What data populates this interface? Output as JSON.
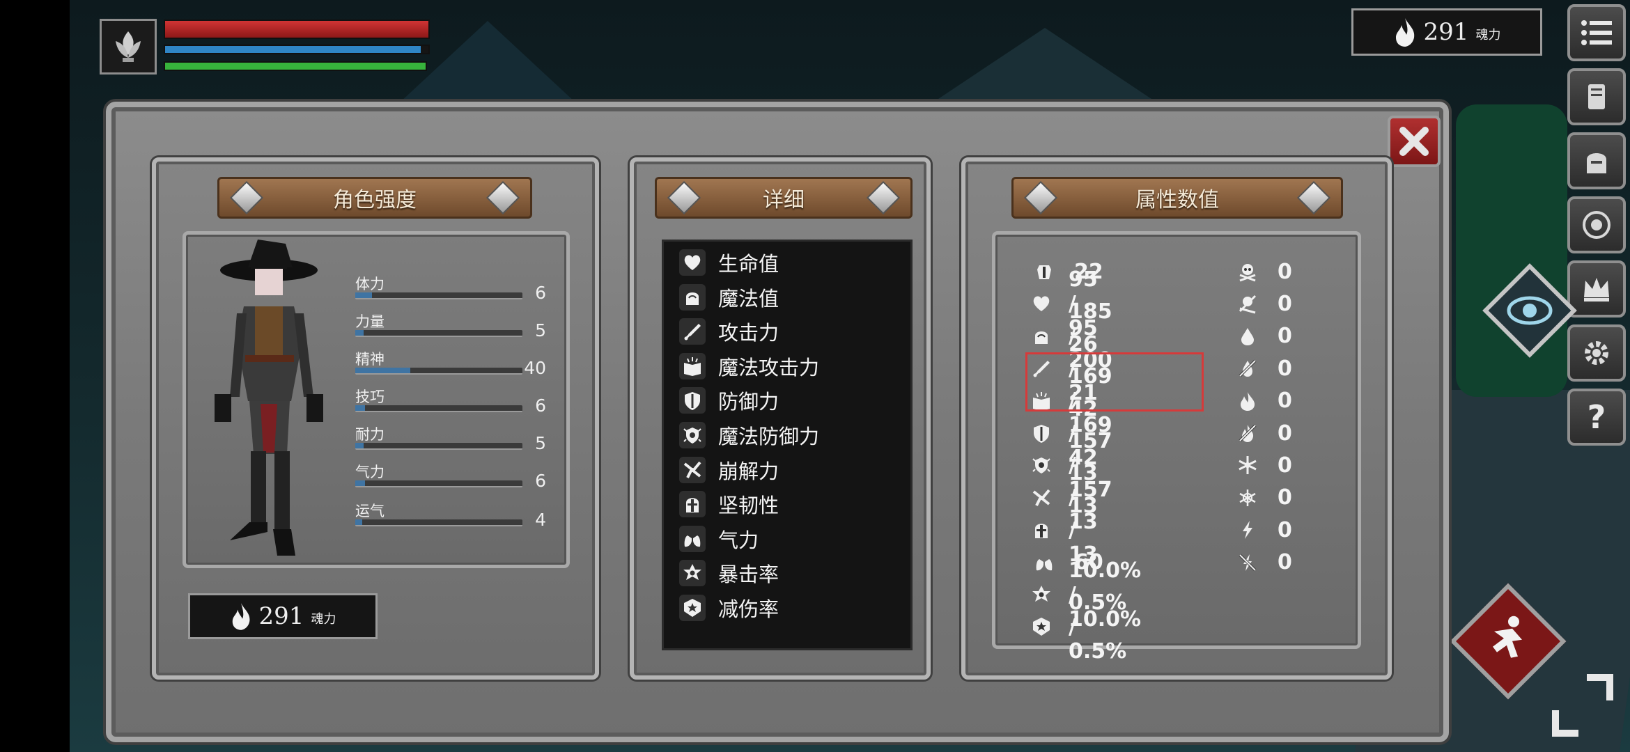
{
  "hud": {
    "portrait_icon": "lotus-emblem-icon",
    "health_fill": 1.0,
    "mana_fill": 0.97,
    "stamina_fill": 1.0,
    "colors": {
      "health": "#b32020",
      "mana": "#2f86c6",
      "stamina": "#37b33c"
    }
  },
  "soul_top": {
    "value": "291",
    "unit": "魂力",
    "icon": "flame-icon"
  },
  "menu": [
    {
      "name": "menu-list-button",
      "icon": "list-icon"
    },
    {
      "name": "inventory-button",
      "icon": "scroll-icon"
    },
    {
      "name": "equipment-button",
      "icon": "helmet-icon"
    },
    {
      "name": "skills-button",
      "icon": "emblem-icon"
    },
    {
      "name": "rank-button",
      "icon": "crown-icon"
    },
    {
      "name": "settings-button",
      "icon": "gear-icon"
    },
    {
      "name": "help-button",
      "label": "?",
      "icon": "question-icon"
    }
  ],
  "panels": {
    "character": {
      "title": "角色强度"
    },
    "detail": {
      "title": "详细"
    },
    "values": {
      "title": "属性数值"
    }
  },
  "stats": [
    {
      "label": "体力",
      "value": "6",
      "fill": 0.1
    },
    {
      "label": "力量",
      "value": "5",
      "fill": 0.05
    },
    {
      "label": "精神",
      "value": "40",
      "fill": 0.33
    },
    {
      "label": "技巧",
      "value": "6",
      "fill": 0.06
    },
    {
      "label": "耐力",
      "value": "5",
      "fill": 0.05
    },
    {
      "label": "气力",
      "value": "6",
      "fill": 0.06
    },
    {
      "label": "运气",
      "value": "4",
      "fill": 0.04
    }
  ],
  "soul_bottom": {
    "value": "291",
    "unit": "魂力",
    "icon": "flame-icon"
  },
  "details": [
    {
      "label": "生命值",
      "icon": "heart-icon"
    },
    {
      "label": "魔法值",
      "icon": "head-icon"
    },
    {
      "label": "攻击力",
      "icon": "sword-icon"
    },
    {
      "label": "魔法攻击力",
      "icon": "spellbook-icon"
    },
    {
      "label": "防御力",
      "icon": "shield-icon"
    },
    {
      "label": "魔法防御力",
      "icon": "magic-shield-icon"
    },
    {
      "label": "崩解力",
      "icon": "break-icon"
    },
    {
      "label": "坚韧性",
      "icon": "helm-icon"
    },
    {
      "label": "气力",
      "icon": "lungs-icon"
    },
    {
      "label": "暴击率",
      "icon": "star-burst-icon"
    },
    {
      "label": "减伤率",
      "icon": "badge-icon"
    }
  ],
  "values_left": [
    {
      "value": "22",
      "icon": "armor-icon"
    },
    {
      "value": "95 / 95",
      "icon": "heart-icon"
    },
    {
      "value": "185 / 200",
      "icon": "head-icon"
    },
    {
      "value": "26 / 21",
      "icon": "sword-icon"
    },
    {
      "value": "169 / 169",
      "icon": "spellbook-icon"
    },
    {
      "value": "42 / 42",
      "icon": "shield-icon"
    },
    {
      "value": "157 / 157",
      "icon": "magic-shield-icon"
    },
    {
      "value": "13 / 13",
      "icon": "break-icon"
    },
    {
      "value": "13 / 13",
      "icon": "helm-icon"
    },
    {
      "value": "60",
      "icon": "lungs-icon"
    },
    {
      "value": "10.0% / 10.0%",
      "icon": "star-burst-icon"
    },
    {
      "value": "0.5% / 0.5%",
      "icon": "badge-icon"
    }
  ],
  "values_right": [
    {
      "value": "0",
      "icon": "skull-icon"
    },
    {
      "value": "0",
      "icon": "skull-resist-icon"
    },
    {
      "value": "0",
      "icon": "blood-drop-icon"
    },
    {
      "value": "0",
      "icon": "bleed-resist-icon"
    },
    {
      "value": "0",
      "icon": "fire-icon"
    },
    {
      "value": "0",
      "icon": "fire-resist-icon"
    },
    {
      "value": "0",
      "icon": "snowflake-icon"
    },
    {
      "value": "0",
      "icon": "frost-resist-icon"
    },
    {
      "value": "0",
      "icon": "lightning-icon"
    },
    {
      "value": "0",
      "icon": "lightning-resist-icon"
    }
  ],
  "close_icon": "close-icon",
  "action_icons": [
    "eye-icon",
    "dash-icon"
  ]
}
